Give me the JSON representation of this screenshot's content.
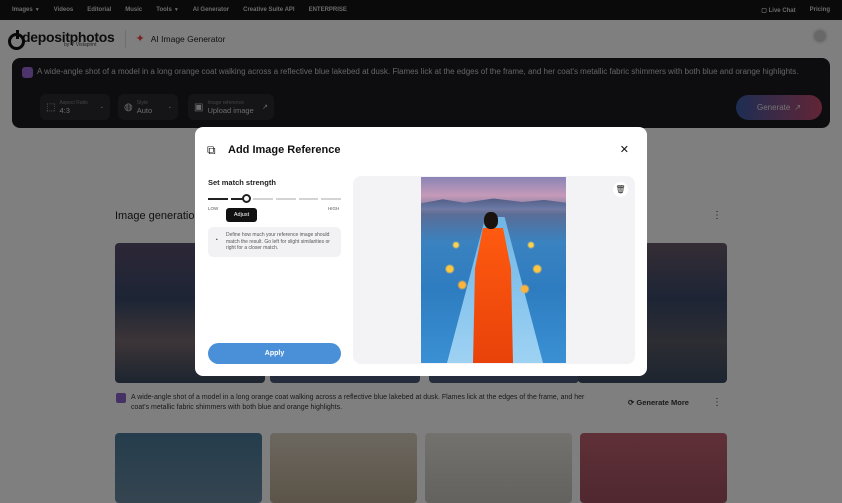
{
  "topnav": {
    "items": [
      "Images",
      "Videos",
      "Editorial",
      "Music",
      "Tools",
      "AI Generator",
      "Creative Suite API",
      "ENTERPRISE"
    ],
    "live_chat": "Live Chat",
    "pricing": "Pricing"
  },
  "header": {
    "logo": "depositphotos",
    "logo_sub": "by ⊽ Vistaprint",
    "section": "AI Image Generator"
  },
  "prompt": {
    "text": "A wide-angle shot of a model in a long orange coat walking across a reflective blue lakebed at dusk. Flames lick at the edges of the frame, and her coat's metallic fabric shimmers with both blue and orange highlights.",
    "controls": [
      {
        "label": "Aspect Ratio",
        "value": "4:3",
        "icon": "aspect-icon"
      },
      {
        "label": "Style",
        "value": "Auto",
        "icon": "style-icon"
      },
      {
        "label": "Image reference",
        "value": "Upload image",
        "icon": "image-icon"
      }
    ],
    "generate": "Generate"
  },
  "results": {
    "title": "Image generation",
    "caption": "A wide-angle shot of a model in a long orange coat walking across a reflective blue lakebed at dusk. Flames lick at the edges of the frame, and her coat's metallic fabric shimmers with both blue and orange highlights.",
    "generate_more": "Generate More"
  },
  "modal": {
    "title": "Add Image Reference",
    "strength_label": "Set match strength",
    "low": "LOW",
    "high": "HIGH",
    "tooltip": "Adjust",
    "info": "Define how much your reference image should match the result. Go left for slight similarities or right for a closer match.",
    "apply": "Apply",
    "strength_value": 0.3
  },
  "colors": {
    "accent": "#4a90d9",
    "generate_from": "#3b5ba8",
    "generate_to": "#c44a6a"
  }
}
